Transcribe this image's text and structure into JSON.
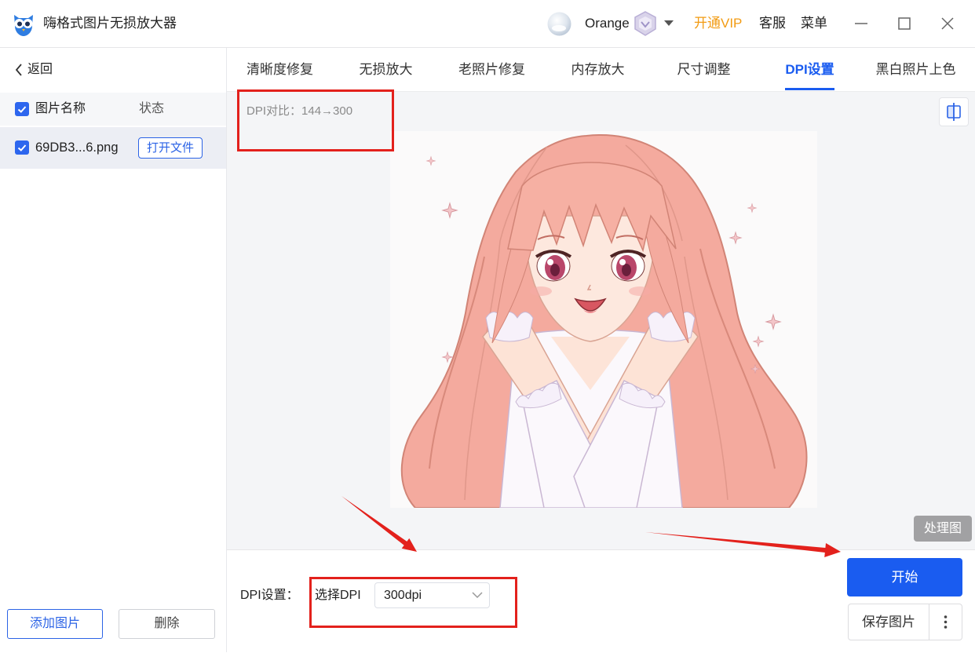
{
  "window": {
    "title": "嗨格式图片无损放大器",
    "user_name": "Orange",
    "vip_label": "开通VIP",
    "service_label": "客服",
    "menu_label": "菜单"
  },
  "sidebar": {
    "back_label": "返回",
    "columns": {
      "name": "图片名称",
      "status": "状态"
    },
    "files": [
      {
        "name": "69DB3...6.png",
        "open_label": "打开文件",
        "checked": true
      }
    ],
    "add_label": "添加图片",
    "delete_label": "删除"
  },
  "tabs": [
    {
      "label": "清晰度修复"
    },
    {
      "label": "无损放大"
    },
    {
      "label": "老照片修复"
    },
    {
      "label": "内存放大"
    },
    {
      "label": "尺寸调整"
    },
    {
      "label": "DPI设置",
      "active": true
    },
    {
      "label": "黑白照片上色"
    }
  ],
  "preview": {
    "dpi_compare": "DPI对比：144→300",
    "processed_label": "处理图"
  },
  "settings": {
    "dpi_label": "DPI设置：",
    "select_label": "选择DPI",
    "selected_dpi": "300dpi"
  },
  "actions": {
    "start_label": "开始",
    "save_label": "保存图片"
  },
  "icons": {
    "logo": "owl-logo-icon",
    "avatar": "avatar",
    "vip_badge": "vip-badge-icon",
    "user_dropdown": "caret-down-icon",
    "minimize": "minimize-icon",
    "maximize": "maximize-icon",
    "close": "close-icon",
    "back": "chevron-left-icon",
    "checkbox": "checkbox-checked-icon",
    "compare": "compare-view-icon",
    "select": "chevron-down-icon",
    "more": "more-vertical-icon"
  },
  "colors": {
    "accent": "#1a5cf0",
    "vip": "#f29b12",
    "annotation": "#e3211c",
    "processed_badge": "#a1a1a3"
  }
}
